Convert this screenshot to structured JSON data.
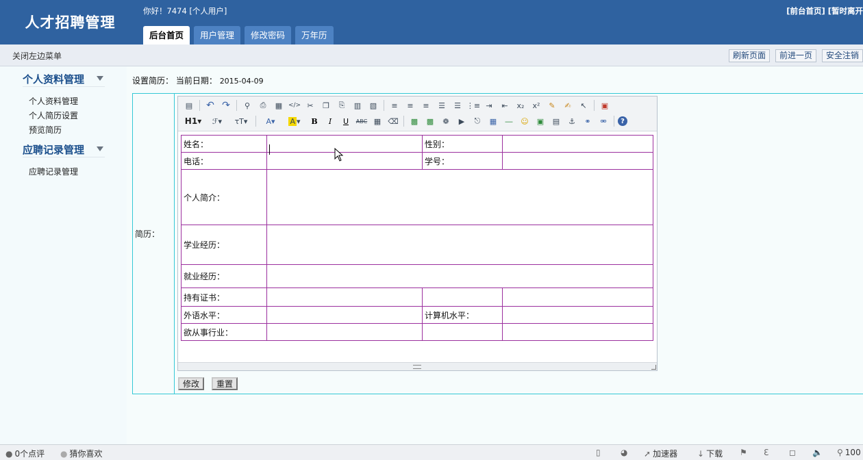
{
  "header": {
    "logo": "人才招聘管理",
    "greeting": "你好！7474 [个人用户]",
    "links": [
      "[前台首页]",
      "[暂时离开"
    ]
  },
  "tabs": [
    {
      "label": "后台首页",
      "active": true
    },
    {
      "label": "用户管理",
      "active": false
    },
    {
      "label": "修改密码",
      "active": false
    },
    {
      "label": "万年历",
      "active": false
    }
  ],
  "subbar": {
    "close_menu": "关闭左边菜单",
    "buttons": [
      "刷新页面",
      "前进一页",
      "安全注销"
    ]
  },
  "sidebar": {
    "sections": [
      {
        "title": "个人资料管理",
        "items": [
          "个人资料管理",
          "个人简历设置",
          "预览简历"
        ]
      },
      {
        "title": "应聘记录管理",
        "items": [
          "应聘记录管理"
        ]
      }
    ]
  },
  "main": {
    "heading_label": "设置简历：",
    "date_label": "当前日期：",
    "date_value": "2015-04-09",
    "resume_label": "简历：",
    "table": {
      "name": "姓名：",
      "gender": "性别：",
      "phone": "电话：",
      "student_id": "学号：",
      "intro": "个人简介：",
      "education": "学业经历：",
      "employment": "就业经历：",
      "certificates": "持有证书：",
      "language": "外语水平：",
      "computer": "计算机水平：",
      "industry": "欲从事行业："
    },
    "submit_label": "修改",
    "reset_label": "重置"
  },
  "toolbar": {
    "row1": [
      "source-icon",
      "undo-icon",
      "redo-icon",
      "preview-icon",
      "print-icon",
      "template-icon",
      "code-icon",
      "cut-icon",
      "copy-icon",
      "paste-icon",
      "paste-text-icon",
      "paste-word-icon",
      "align-left-icon",
      "align-center-icon",
      "align-right-icon",
      "justify-icon",
      "ordered-list-icon",
      "unordered-list-icon",
      "indent-icon",
      "outdent-icon",
      "subscript-icon",
      "superscript-icon",
      "clear-format-icon",
      "quick-format-icon",
      "select-all-icon",
      "fullscreen-icon"
    ],
    "row2": [
      "heading-icon",
      "font-family-icon",
      "font-size-icon",
      "font-color-icon",
      "highlight-icon",
      "bold-icon",
      "italic-icon",
      "underline-icon",
      "strikethrough-icon",
      "line-height-icon",
      "remove-format-icon",
      "image-icon",
      "multi-image-icon",
      "flash-icon",
      "media-icon",
      "attachment-icon",
      "table-icon",
      "horizontal-line-icon",
      "emoticon-icon",
      "map-icon",
      "page-break-icon",
      "anchor-icon",
      "link-icon",
      "unlink-icon",
      "help-icon"
    ],
    "heading_text": "H1",
    "bold_text": "B",
    "italic_text": "I",
    "underline_text": "U",
    "strike_text": "ABC"
  },
  "browser_bar": {
    "comments": "0个点评",
    "recommend": "猜你喜欢",
    "accelerator": "加速器",
    "download": "下载",
    "zoom": "100"
  },
  "colors": {
    "header": "#2f62a0",
    "tab": "#4d82c3",
    "table_border": "#9b2f9e",
    "form_border": "#33c8d6",
    "sidebar_title": "#1b4f8c"
  }
}
